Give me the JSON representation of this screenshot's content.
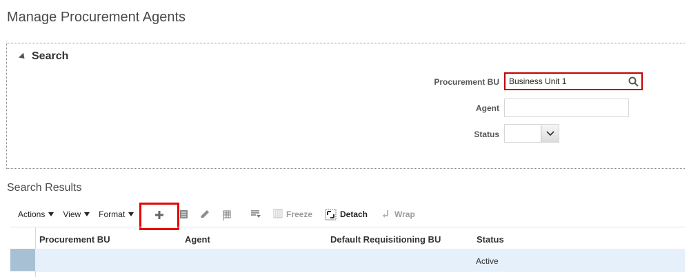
{
  "page": {
    "title": "Manage Procurement Agents"
  },
  "search": {
    "header": "Search",
    "fields": {
      "procurement_bu": {
        "label": "Procurement BU",
        "value": "Business Unit 1"
      },
      "agent": {
        "label": "Agent",
        "value": ""
      },
      "status": {
        "label": "Status",
        "value": ""
      }
    }
  },
  "results": {
    "title": "Search Results",
    "toolbar": {
      "actions": "Actions",
      "view": "View",
      "format": "Format",
      "freeze": "Freeze",
      "detach": "Detach",
      "wrap": "Wrap"
    },
    "columns": [
      "Procurement BU",
      "Agent",
      "Default Requisitioning BU",
      "Status"
    ],
    "rows": [
      {
        "procurement_bu": "",
        "agent": "",
        "default_req_bu": "",
        "status": "Active"
      }
    ]
  },
  "colors": {
    "highlight": "#e60000",
    "selected_row": "#e5f0fb",
    "selector": "#a8c0d4"
  },
  "icons": [
    "search-icon",
    "chevron-down-icon",
    "add-icon",
    "edit-icon"
  ]
}
